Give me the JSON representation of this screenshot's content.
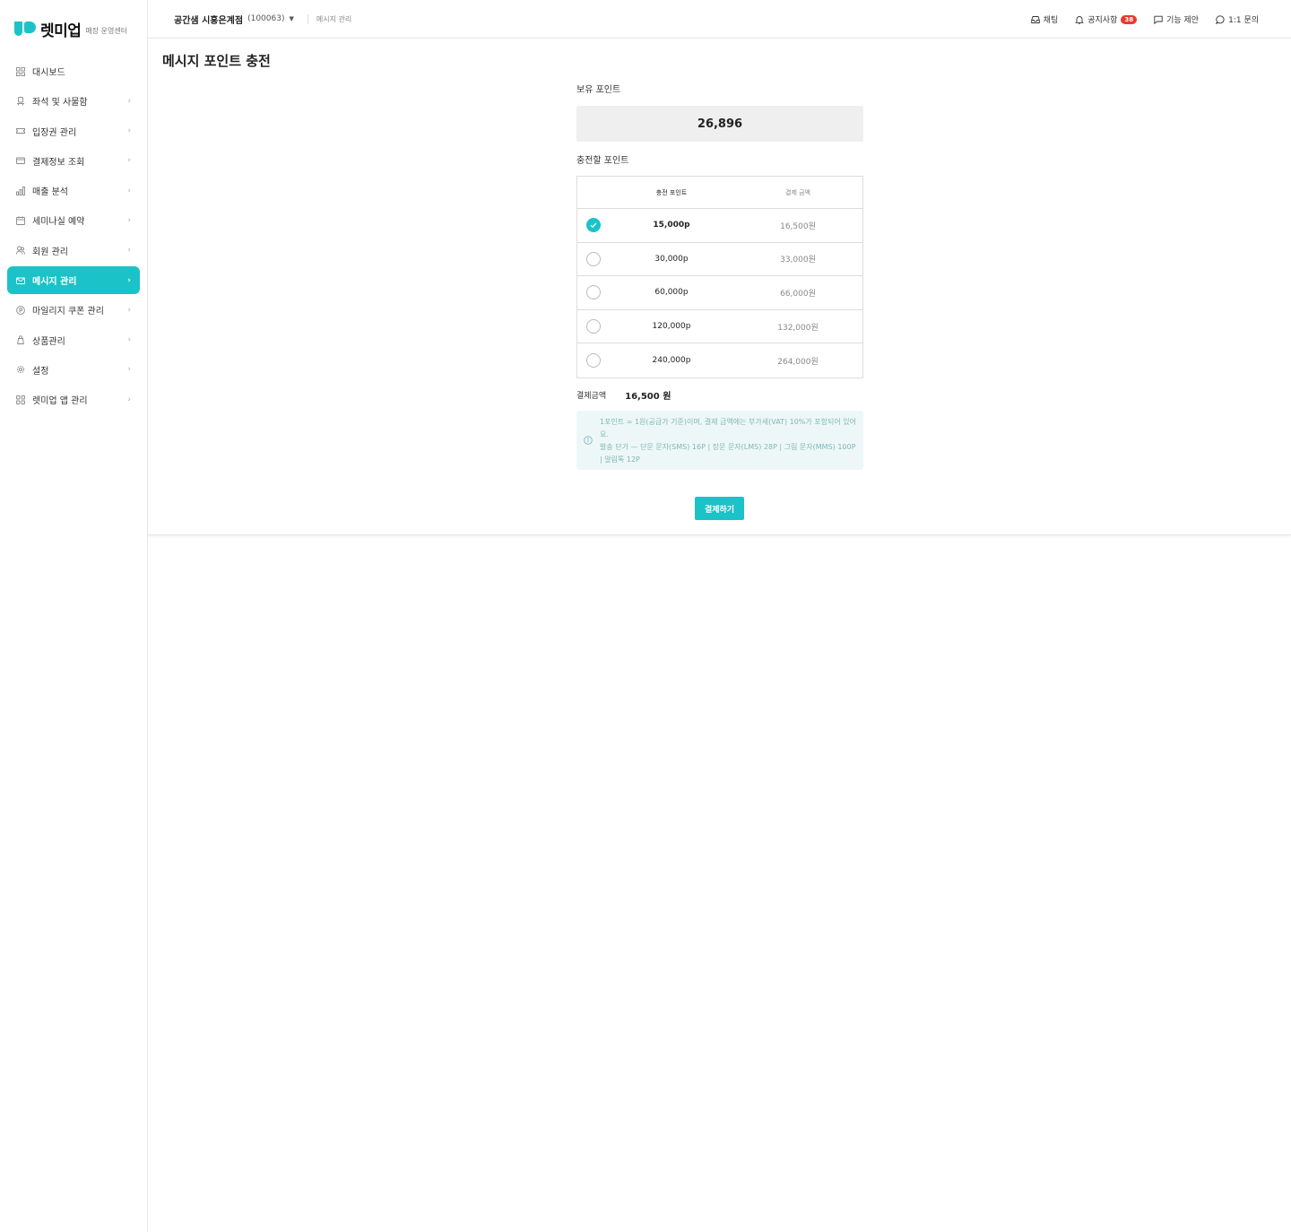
{
  "brand": {
    "name": "렛미업",
    "sub": "매장 운영센터",
    "accent": "#1bc3c8"
  },
  "sidebar": {
    "items": [
      {
        "label": "대시보드",
        "icon": "grid-icon",
        "chevron": false,
        "active": false
      },
      {
        "label": "좌석 및 사물함",
        "icon": "seat-icon",
        "chevron": true,
        "active": false
      },
      {
        "label": "입장권 관리",
        "icon": "ticket-icon",
        "chevron": true,
        "active": false
      },
      {
        "label": "결제정보 조회",
        "icon": "card-icon",
        "chevron": true,
        "active": false
      },
      {
        "label": "매출 분석",
        "icon": "bar-chart-icon",
        "chevron": true,
        "active": false
      },
      {
        "label": "세미나실 예약",
        "icon": "calendar-icon",
        "chevron": true,
        "active": false
      },
      {
        "label": "회원 관리",
        "icon": "users-icon",
        "chevron": true,
        "active": false
      },
      {
        "label": "메시지 관리",
        "icon": "mail-icon",
        "chevron": true,
        "active": true
      },
      {
        "label": "마일리지 쿠폰 관리",
        "icon": "coin-icon",
        "chevron": true,
        "active": false
      },
      {
        "label": "상품관리",
        "icon": "product-icon",
        "chevron": true,
        "active": false
      },
      {
        "label": "설정",
        "icon": "gear-icon",
        "chevron": true,
        "active": false
      },
      {
        "label": "렛미업 앱 관리",
        "icon": "apps-icon",
        "chevron": true,
        "active": false
      }
    ]
  },
  "header": {
    "store_name": "공간샘 시흥은계점",
    "store_id": "(100063)",
    "breadcrumb": "메시지 관리",
    "chat": "채팅",
    "notice": "공지사항",
    "notice_count": "38",
    "suggest": "기능 제안",
    "inquiry": "1:1 문의"
  },
  "main": {
    "title": "메시지 포인트 충전",
    "held_label": "보유 포인트",
    "held_points": "26,896",
    "charge_label": "충전할 포인트",
    "table": {
      "col_points": "충전 포인트",
      "col_amount": "결제 금액",
      "rows": [
        {
          "points": "15,000p",
          "amount": "16,500원",
          "selected": true
        },
        {
          "points": "30,000p",
          "amount": "33,000원",
          "selected": false
        },
        {
          "points": "60,000p",
          "amount": "66,000원",
          "selected": false
        },
        {
          "points": "120,000p",
          "amount": "132,000원",
          "selected": false
        },
        {
          "points": "240,000p",
          "amount": "264,000원",
          "selected": false
        }
      ]
    },
    "total_label": "결제금액",
    "total_value": "16,500 원",
    "info_line1": "1포인트 = 1원(공급가 기준)이며, 결제 금액에는 부가세(VAT) 10%가 포함되어 있어요.",
    "info_line2": "발송 단가 — 단문 문자(SMS) 16P | 장문 문자(LMS) 28P | 그림 문자(MMS) 100P | 알림톡 12P",
    "pay_button": "결제하기"
  }
}
